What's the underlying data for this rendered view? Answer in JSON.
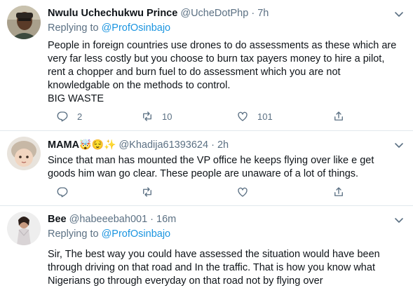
{
  "tweets": [
    {
      "name": "Nwulu Uchechukwu Prince",
      "name_suffix": "",
      "handle": "@UcheDotPhp",
      "separator": "·",
      "time": "7h",
      "reply_prefix": "Replying to",
      "reply_to": "@ProfOsinbajo",
      "lines": [
        "People in foreign countries use drones to do assessments as these which are",
        "very far less costly but you choose to burn tax payers money to hire a pilot,",
        "rent a chopper and burn fuel to do assessment which you are not",
        "knowledgable on the methods to control.",
        "BIG WASTE"
      ],
      "reply_count": "2",
      "retweet_count": "10",
      "like_count": "101"
    },
    {
      "name": "MAMA",
      "name_suffix": "🤯😌✨",
      "handle": "@Khadija61393624",
      "separator": "·",
      "time": "2h",
      "lines": [
        "Since that man has mounted the VP office he keeps flying over like e get",
        "goods him wan go clear. These people are unaware of a lot of things."
      ]
    },
    {
      "name": "Bee",
      "handle": "@habeeebah001",
      "separator": "·",
      "time": "16m",
      "reply_prefix": "Replying to",
      "reply_to": "@ProfOsinbajo",
      "lines": [
        "Sir, The best way you could have assessed the situation would have been",
        "through driving on that road and In the traffic. That is how you know what",
        "Nigerians go through everyday on that road not by flying over"
      ]
    }
  ],
  "colors": {
    "text": "#0f1419",
    "secondary": "#5b7083",
    "link": "#1b95e0",
    "divider": "#e1e8ed"
  },
  "icons": [
    "reply-icon",
    "retweet-icon",
    "like-icon",
    "share-icon",
    "chevron-down-icon"
  ]
}
